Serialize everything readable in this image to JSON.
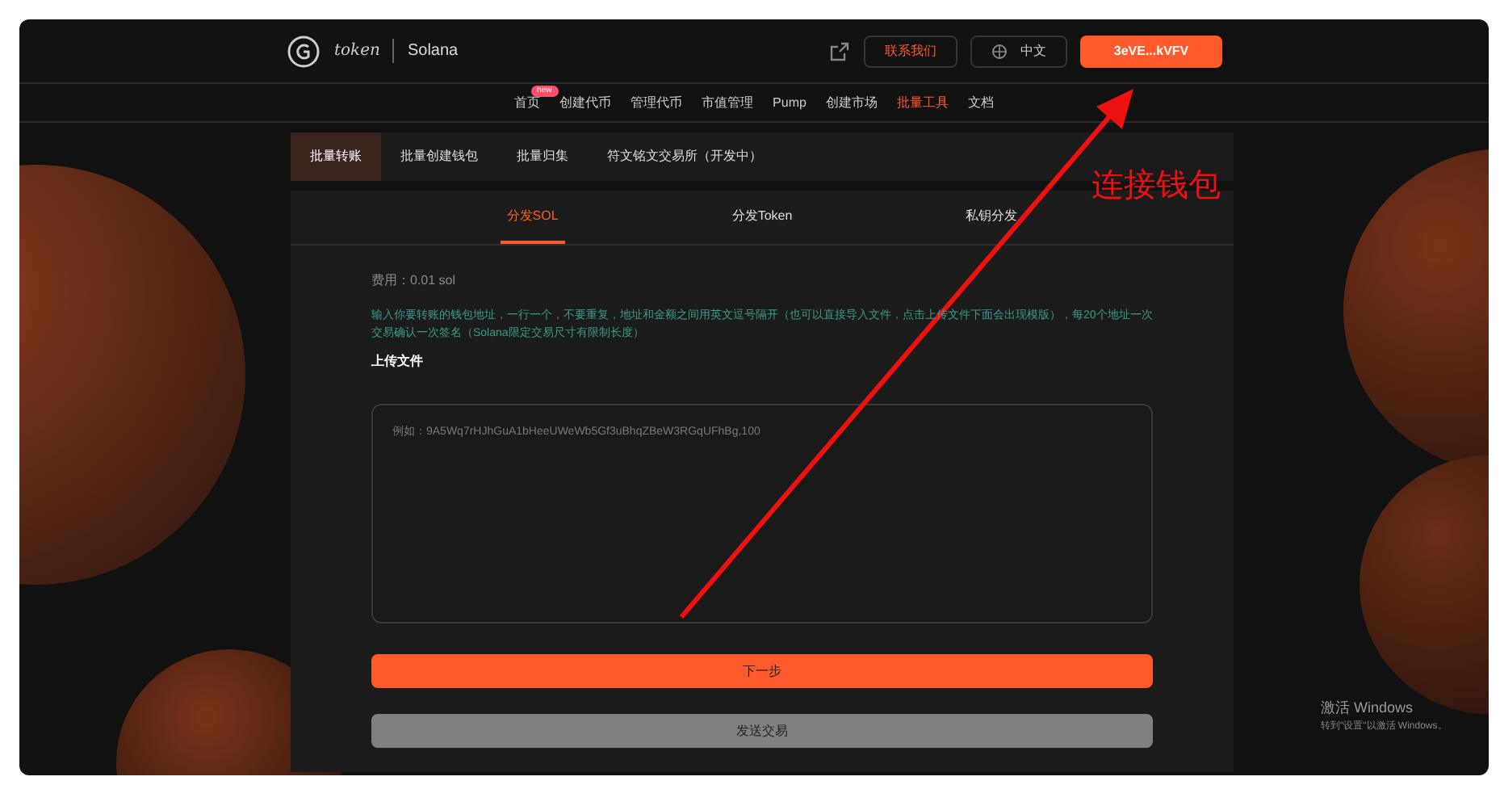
{
  "header": {
    "logo_text": "token",
    "chain": "Solana",
    "contact_button": "联系我们",
    "language": "中文",
    "wallet_button": "3eVE...kVFV"
  },
  "nav": {
    "badge": "new",
    "items": [
      {
        "label": "首页",
        "selected": false
      },
      {
        "label": "创建代币",
        "selected": false
      },
      {
        "label": "管理代币",
        "selected": false
      },
      {
        "label": "市值管理",
        "selected": false
      },
      {
        "label": "Pump",
        "selected": false
      },
      {
        "label": "创建市场",
        "selected": false
      },
      {
        "label": "批量工具",
        "selected": true
      },
      {
        "label": "文档",
        "selected": false
      }
    ]
  },
  "sub_tabs": [
    {
      "label": "批量转账",
      "selected": true
    },
    {
      "label": "批量创建钱包",
      "selected": false
    },
    {
      "label": "批量归集",
      "selected": false
    },
    {
      "label": "符文铭文交易所（开发中）",
      "selected": false
    }
  ],
  "panel": {
    "tabs": [
      {
        "label": "分发SOL",
        "selected": true
      },
      {
        "label": "分发Token",
        "selected": false
      },
      {
        "label": "私钥分发",
        "selected": false
      }
    ],
    "fee": "费用：0.01 sol",
    "description": "输入你要转账的钱包地址，一行一个，不要重复，地址和金额之间用英文逗号隔开（也可以直接导入文件，点击上传文件下面会出现模版），每20个地址一次交易确认一次签名（Solana限定交易尺寸有限制长度）",
    "upload_label": "上传文件",
    "textarea": {
      "placeholder": "例如：9A5Wq7rHJhGuA1bHeeUWeWb5Gf3uBhqZBeW3RGqUFhBg,100"
    },
    "next_button": "下一步",
    "send_button": "发送交易"
  },
  "annotation": "连接钱包",
  "os_notice": {
    "title": "激活 Windows",
    "subtitle": "转到\"设置\"以激活 Windows。"
  }
}
